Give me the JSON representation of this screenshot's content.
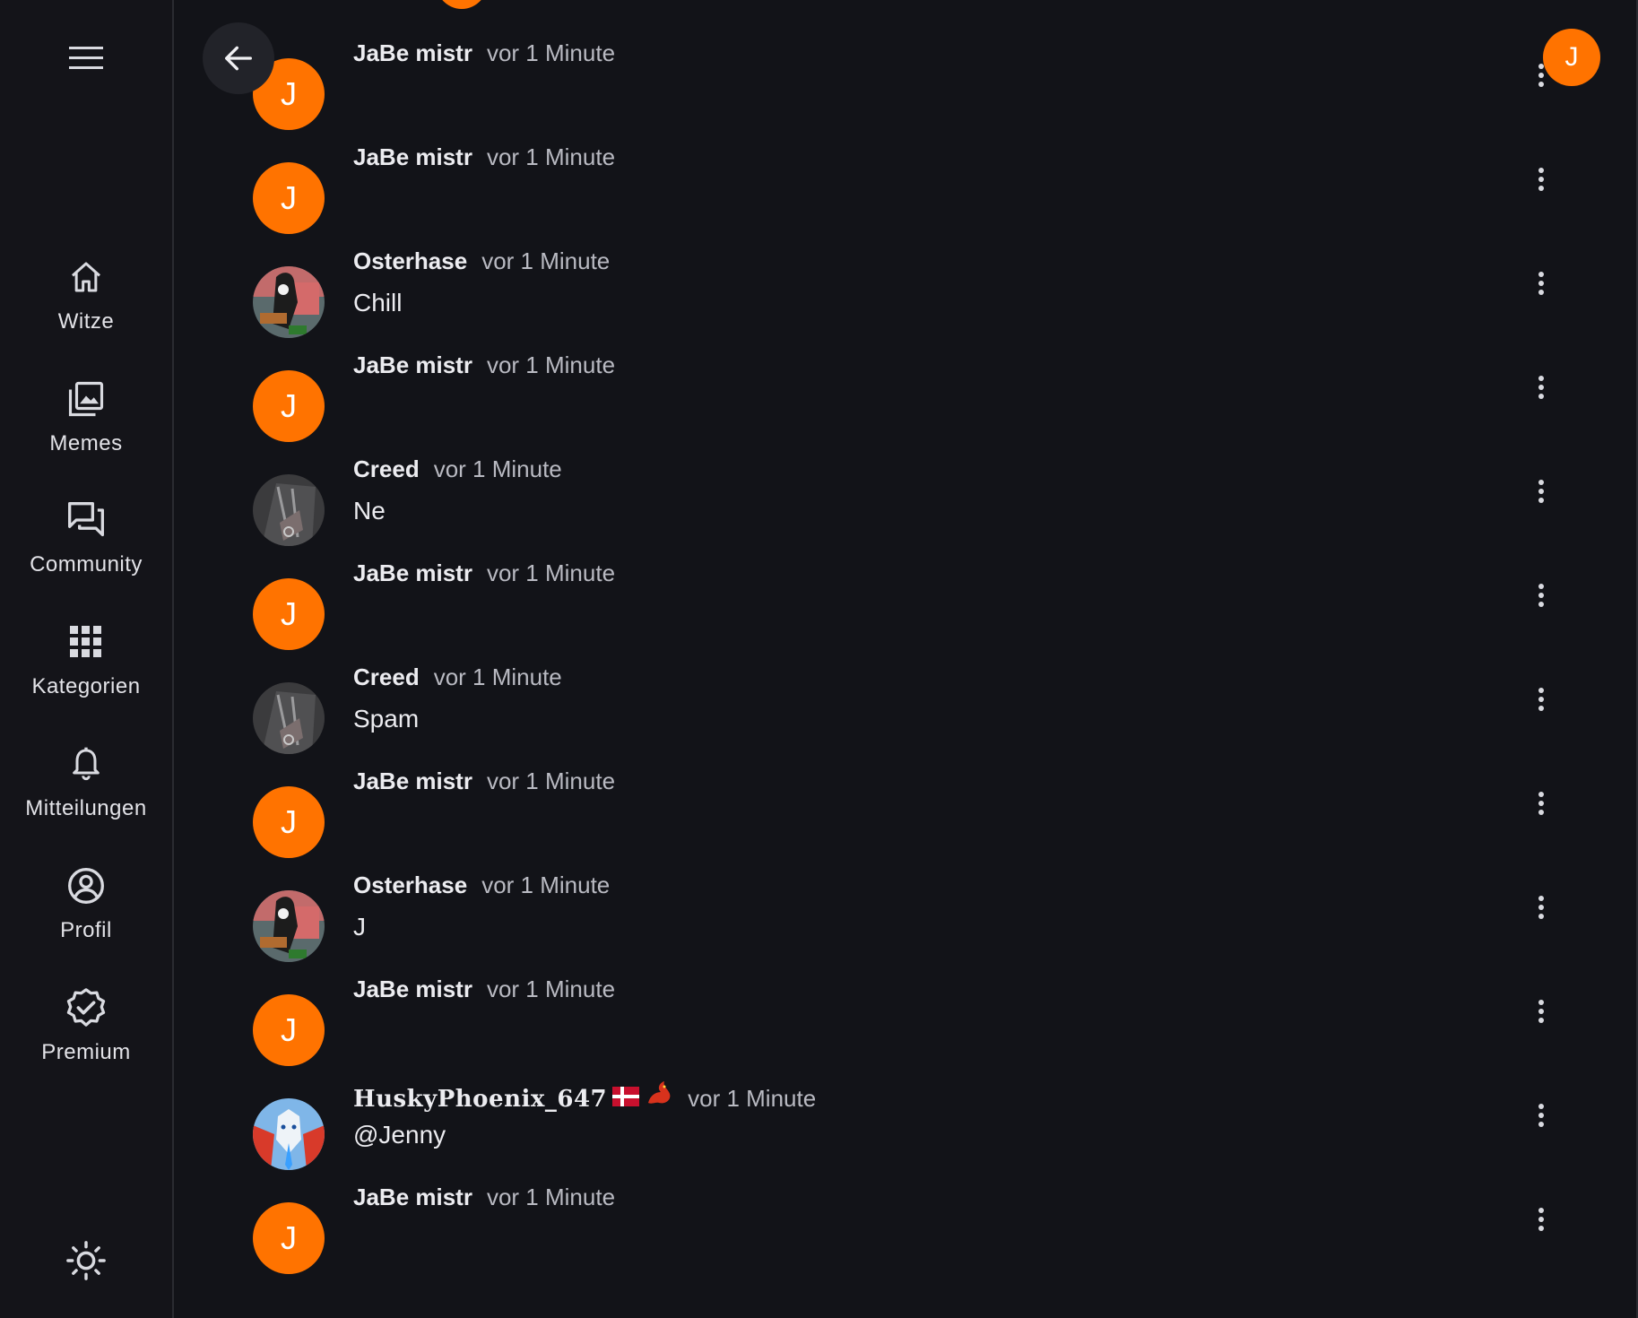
{
  "nav": {
    "items": [
      {
        "label": "Witze",
        "icon": "home-icon"
      },
      {
        "label": "Memes",
        "icon": "images-icon"
      },
      {
        "label": "Community",
        "icon": "forum-icon"
      },
      {
        "label": "Kategorien",
        "icon": "grid-icon"
      },
      {
        "label": "Mitteilungen",
        "icon": "bell-icon"
      },
      {
        "label": "Profil",
        "icon": "profile-icon"
      },
      {
        "label": "Premium",
        "icon": "verified-badge-icon"
      }
    ],
    "menu_icon": "hamburger-icon",
    "theme_icon": "sun-icon"
  },
  "header": {
    "back_icon": "arrow-left-icon",
    "user_initial": "J"
  },
  "colors": {
    "accent": "#ff7300",
    "background": "#121318",
    "sidebar": "#141419"
  },
  "messages": [
    {
      "author": "JaBe mistr",
      "time": "vor 1 Minute",
      "text": "",
      "avatar": "J"
    },
    {
      "author": "JaBe mistr",
      "time": "vor 1 Minute",
      "text": "",
      "avatar": "J"
    },
    {
      "author": "Osterhase",
      "time": "vor 1 Minute",
      "text": "Chill",
      "avatar": "image"
    },
    {
      "author": "JaBe mistr",
      "time": "vor 1 Minute",
      "text": "",
      "avatar": "J"
    },
    {
      "author": "Creed",
      "time": "vor 1 Minute",
      "text": "Ne",
      "avatar": "image"
    },
    {
      "author": "JaBe mistr",
      "time": "vor 1 Minute",
      "text": "",
      "avatar": "J"
    },
    {
      "author": "Creed",
      "time": "vor 1 Minute",
      "text": "Spam",
      "avatar": "image"
    },
    {
      "author": "JaBe mistr",
      "time": "vor 1 Minute",
      "text": "",
      "avatar": "J"
    },
    {
      "author": "Osterhase",
      "time": "vor 1 Minute",
      "text": "J",
      "avatar": "image"
    },
    {
      "author": "JaBe mistr",
      "time": "vor 1 Minute",
      "text": "",
      "avatar": "J"
    },
    {
      "author": "HuskyPhoenix_647",
      "time": "vor 1 Minute",
      "text": "@Jenny",
      "avatar": "image"
    },
    {
      "author": "JaBe mistr",
      "time": "vor 1 Minute",
      "text": "",
      "avatar": "J"
    }
  ]
}
